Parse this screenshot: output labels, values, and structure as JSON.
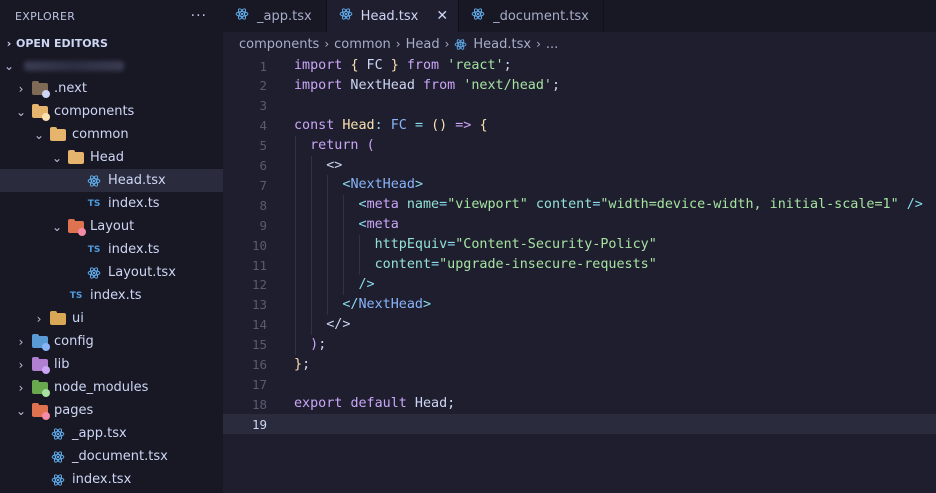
{
  "explorer": {
    "title": "EXPLORER",
    "more": "···",
    "open_editors": "OPEN EDITORS",
    "tree": [
      {
        "label": ".next",
        "depth": 0,
        "chevron": "›",
        "icon": "next-folder-icon",
        "color": "#7f6a56",
        "badge": "#cdd6f4"
      },
      {
        "label": "components",
        "depth": 0,
        "chevron": "⌄",
        "icon": "components-folder-icon",
        "color": "#e5b46d",
        "badge": "#f9e2af"
      },
      {
        "label": "common",
        "depth": 1,
        "chevron": "⌄",
        "icon": "folder-open-icon",
        "color": "#e5b46d"
      },
      {
        "label": "Head",
        "depth": 2,
        "chevron": "⌄",
        "icon": "folder-open-icon",
        "color": "#e5b46d"
      },
      {
        "label": "Head.tsx",
        "depth": 3,
        "chevron": "",
        "icon": "react-icon",
        "selected": true
      },
      {
        "label": "index.ts",
        "depth": 3,
        "chevron": "",
        "icon": "typescript-icon"
      },
      {
        "label": "Layout",
        "depth": 2,
        "chevron": "⌄",
        "icon": "layout-folder-icon",
        "color": "#e0734f",
        "badge": "#f38ba8"
      },
      {
        "label": "index.ts",
        "depth": 3,
        "chevron": "",
        "icon": "typescript-icon"
      },
      {
        "label": "Layout.tsx",
        "depth": 3,
        "chevron": "",
        "icon": "react-icon"
      },
      {
        "label": "index.ts",
        "depth": 2,
        "chevron": "",
        "icon": "typescript-icon"
      },
      {
        "label": "ui",
        "depth": 1,
        "chevron": "›",
        "icon": "folder-icon",
        "color": "#d9a857"
      },
      {
        "label": "config",
        "depth": 0,
        "chevron": "›",
        "icon": "config-folder-icon",
        "color": "#5b9bd5",
        "badge": "#89b4fa"
      },
      {
        "label": "lib",
        "depth": 0,
        "chevron": "›",
        "icon": "lib-folder-icon",
        "color": "#b07fd1",
        "badge": "#cba6f7"
      },
      {
        "label": "node_modules",
        "depth": 0,
        "chevron": "›",
        "icon": "node-modules-folder-icon",
        "color": "#6aa84f",
        "badge": "#a6e3a1"
      },
      {
        "label": "pages",
        "depth": 0,
        "chevron": "⌄",
        "icon": "pages-folder-icon",
        "color": "#e0734f",
        "badge": "#f38ba8"
      },
      {
        "label": "_app.tsx",
        "depth": 1,
        "chevron": "",
        "icon": "react-icon"
      },
      {
        "label": "_document.tsx",
        "depth": 1,
        "chevron": "",
        "icon": "react-icon"
      },
      {
        "label": "index.tsx",
        "depth": 1,
        "chevron": "",
        "icon": "react-icon"
      }
    ]
  },
  "tabs": [
    {
      "label": "_app.tsx",
      "active": false
    },
    {
      "label": "Head.tsx",
      "active": true,
      "close": "✕"
    },
    {
      "label": "_document.tsx",
      "active": false
    }
  ],
  "breadcrumb": [
    "components",
    "common",
    "Head",
    "Head.tsx",
    "..."
  ],
  "editor": {
    "current_line": 19,
    "lines": [
      [
        [
          "kw",
          "import"
        ],
        [
          "pn",
          " "
        ],
        [
          "br1",
          "{"
        ],
        [
          "pn",
          " FC "
        ],
        [
          "br1",
          "}"
        ],
        [
          "pn",
          " "
        ],
        [
          "kw",
          "from"
        ],
        [
          "pn",
          " "
        ],
        [
          "st",
          "'react'"
        ],
        [
          "pn",
          ";"
        ]
      ],
      [
        [
          "kw",
          "import"
        ],
        [
          "pn",
          " NextHead "
        ],
        [
          "kw",
          "from"
        ],
        [
          "pn",
          " "
        ],
        [
          "st",
          "'next/head'"
        ],
        [
          "pn",
          ";"
        ]
      ],
      [],
      [
        [
          "kw",
          "const"
        ],
        [
          "pn",
          " "
        ],
        [
          "ty",
          "Head"
        ],
        [
          "op",
          ":"
        ],
        [
          "pn",
          " "
        ],
        [
          "fn",
          "FC"
        ],
        [
          "pn",
          " "
        ],
        [
          "op",
          "="
        ],
        [
          "pn",
          " "
        ],
        [
          "br1",
          "()"
        ],
        [
          "pn",
          " "
        ],
        [
          "kw",
          "=>"
        ],
        [
          "pn",
          " "
        ],
        [
          "br1",
          "{"
        ]
      ],
      [
        [
          "pn",
          "  "
        ],
        [
          "kw",
          "return"
        ],
        [
          "pn",
          " "
        ],
        [
          "br2",
          "("
        ]
      ],
      [
        [
          "pn",
          "    "
        ],
        [
          "pn",
          "<>"
        ]
      ],
      [
        [
          "pn",
          "      "
        ],
        [
          "op",
          "<"
        ],
        [
          "tg",
          "NextHead"
        ],
        [
          "op",
          ">"
        ]
      ],
      [
        [
          "pn",
          "        "
        ],
        [
          "op",
          "<"
        ],
        [
          "kw",
          "meta"
        ],
        [
          "pn",
          " "
        ],
        [
          "at",
          "name"
        ],
        [
          "op",
          "="
        ],
        [
          "vr",
          "\"viewport\""
        ],
        [
          "pn",
          " "
        ],
        [
          "at",
          "content"
        ],
        [
          "op",
          "="
        ],
        [
          "vr",
          "\"width=device-width, initial-scale=1\""
        ],
        [
          "pn",
          " "
        ],
        [
          "op",
          "/>"
        ]
      ],
      [
        [
          "pn",
          "        "
        ],
        [
          "op",
          "<"
        ],
        [
          "kw",
          "meta"
        ]
      ],
      [
        [
          "pn",
          "          "
        ],
        [
          "at",
          "httpEquiv"
        ],
        [
          "op",
          "="
        ],
        [
          "vr",
          "\"Content-Security-Policy\""
        ]
      ],
      [
        [
          "pn",
          "          "
        ],
        [
          "at",
          "content"
        ],
        [
          "op",
          "="
        ],
        [
          "vr",
          "\"upgrade-insecure-requests\""
        ]
      ],
      [
        [
          "pn",
          "        "
        ],
        [
          "op",
          "/>"
        ]
      ],
      [
        [
          "pn",
          "      "
        ],
        [
          "op",
          "</"
        ],
        [
          "tg",
          "NextHead"
        ],
        [
          "op",
          ">"
        ]
      ],
      [
        [
          "pn",
          "    "
        ],
        [
          "pn",
          "</>"
        ]
      ],
      [
        [
          "pn",
          "  "
        ],
        [
          "br2",
          ")"
        ],
        [
          "pn",
          ";"
        ]
      ],
      [
        [
          "br1",
          "}"
        ],
        [
          "pn",
          ";"
        ]
      ],
      [],
      [
        [
          "kw",
          "export"
        ],
        [
          "pn",
          " "
        ],
        [
          "kw",
          "default"
        ],
        [
          "pn",
          " Head;"
        ]
      ],
      []
    ]
  }
}
